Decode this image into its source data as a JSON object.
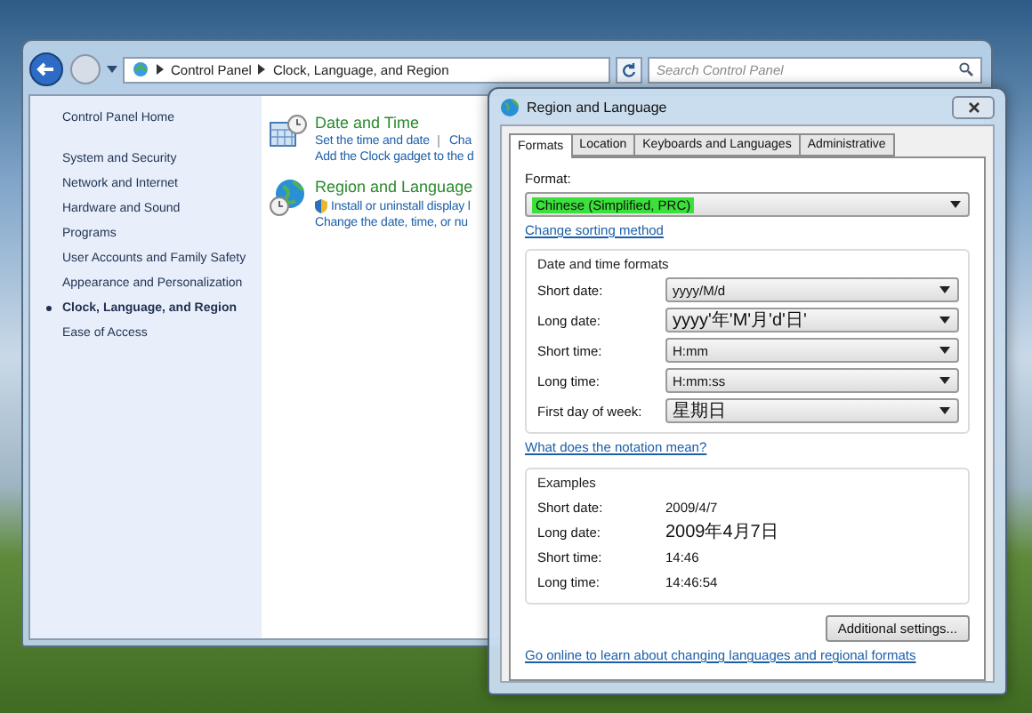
{
  "explorer": {
    "breadcrumb": [
      "Control Panel",
      "Clock, Language, and Region"
    ],
    "search": {
      "placeholder": "Search Control Panel"
    },
    "sidebar": {
      "items": [
        {
          "label": "Control Panel Home",
          "kind": "home",
          "selected": false
        },
        {
          "label": "System and Security",
          "kind": "category",
          "selected": false
        },
        {
          "label": "Network and Internet",
          "kind": "category",
          "selected": false
        },
        {
          "label": "Hardware and Sound",
          "kind": "category",
          "selected": false
        },
        {
          "label": "Programs",
          "kind": "category",
          "selected": false
        },
        {
          "label": "User Accounts and Family Safety",
          "kind": "category",
          "selected": false
        },
        {
          "label": "Appearance and Personalization",
          "kind": "category",
          "selected": false
        },
        {
          "label": "Clock, Language, and Region",
          "kind": "category",
          "selected": true
        },
        {
          "label": "Ease of Access",
          "kind": "category",
          "selected": false
        }
      ]
    },
    "categories": [
      {
        "title": "Date and Time",
        "kind": "clock",
        "rows": [
          [
            {
              "text": "Set the time and date",
              "kind": "plain"
            },
            {
              "text": "Cha",
              "kind": "plain"
            }
          ],
          [
            {
              "text": "Add the Clock gadget to the d",
              "kind": "plain"
            }
          ]
        ]
      },
      {
        "title": "Region and Language",
        "kind": "globe",
        "rows": [
          [
            {
              "text": "Install or uninstall display l",
              "kind": "shield"
            }
          ],
          [
            {
              "text": "Change the date, time, or nu",
              "kind": "plain"
            }
          ]
        ]
      }
    ]
  },
  "dialog": {
    "title": "Region and Language",
    "tabs": [
      {
        "label": "Formats",
        "selected": true
      },
      {
        "label": "Location",
        "selected": false
      },
      {
        "label": "Keyboards and Languages",
        "selected": false
      },
      {
        "label": "Administrative",
        "selected": false
      }
    ],
    "format": {
      "label": "Format:",
      "value": "Chinese (Simplified, PRC)",
      "highlighted": true
    },
    "sort_link": "Change sorting method",
    "formats_group": {
      "title": "Date and time formats",
      "rows": [
        {
          "label": "Short date:",
          "value": "yyyy/M/d"
        },
        {
          "label": "Long date:",
          "value": "yyyy'年'M'月'd'日'"
        },
        {
          "label": "Short time:",
          "value": "H:mm"
        },
        {
          "label": "Long time:",
          "value": "H:mm:ss"
        },
        {
          "label": "First day of week:",
          "value": "星期日"
        }
      ]
    },
    "notation_link": "What does the notation mean?",
    "examples": {
      "title": "Examples",
      "rows": [
        {
          "label": "Short date:",
          "value": "2009/4/7"
        },
        {
          "label": "Long date:",
          "value": "2009年4月7日"
        },
        {
          "label": "Short time:",
          "value": "14:46"
        },
        {
          "label": "Long time:",
          "value": "14:46:54"
        }
      ]
    },
    "additional_button": "Additional settings...",
    "online_link": "Go online to learn about changing languages and regional formats"
  }
}
